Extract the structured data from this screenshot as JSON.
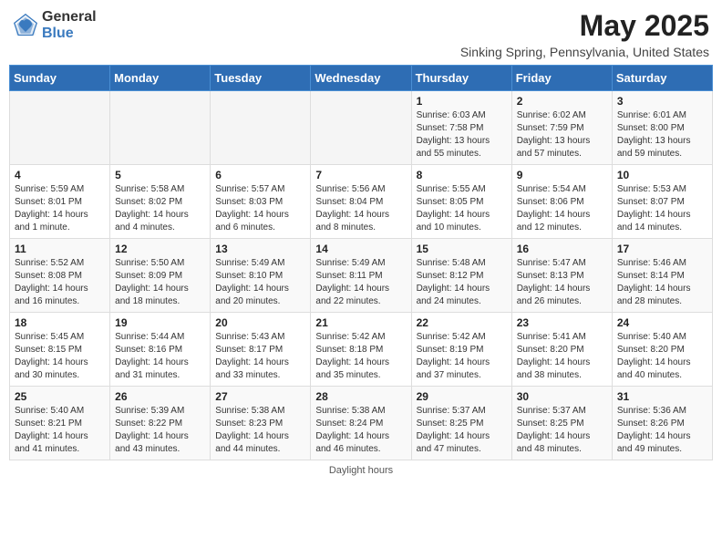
{
  "header": {
    "logo_general": "General",
    "logo_blue": "Blue",
    "month_year": "May 2025",
    "location": "Sinking Spring, Pennsylvania, United States"
  },
  "days_of_week": [
    "Sunday",
    "Monday",
    "Tuesday",
    "Wednesday",
    "Thursday",
    "Friday",
    "Saturday"
  ],
  "footer": {
    "note": "Daylight hours"
  },
  "weeks": [
    [
      {
        "day": "",
        "info": ""
      },
      {
        "day": "",
        "info": ""
      },
      {
        "day": "",
        "info": ""
      },
      {
        "day": "",
        "info": ""
      },
      {
        "day": "1",
        "info": "Sunrise: 6:03 AM\nSunset: 7:58 PM\nDaylight: 13 hours\nand 55 minutes."
      },
      {
        "day": "2",
        "info": "Sunrise: 6:02 AM\nSunset: 7:59 PM\nDaylight: 13 hours\nand 57 minutes."
      },
      {
        "day": "3",
        "info": "Sunrise: 6:01 AM\nSunset: 8:00 PM\nDaylight: 13 hours\nand 59 minutes."
      }
    ],
    [
      {
        "day": "4",
        "info": "Sunrise: 5:59 AM\nSunset: 8:01 PM\nDaylight: 14 hours\nand 1 minute."
      },
      {
        "day": "5",
        "info": "Sunrise: 5:58 AM\nSunset: 8:02 PM\nDaylight: 14 hours\nand 4 minutes."
      },
      {
        "day": "6",
        "info": "Sunrise: 5:57 AM\nSunset: 8:03 PM\nDaylight: 14 hours\nand 6 minutes."
      },
      {
        "day": "7",
        "info": "Sunrise: 5:56 AM\nSunset: 8:04 PM\nDaylight: 14 hours\nand 8 minutes."
      },
      {
        "day": "8",
        "info": "Sunrise: 5:55 AM\nSunset: 8:05 PM\nDaylight: 14 hours\nand 10 minutes."
      },
      {
        "day": "9",
        "info": "Sunrise: 5:54 AM\nSunset: 8:06 PM\nDaylight: 14 hours\nand 12 minutes."
      },
      {
        "day": "10",
        "info": "Sunrise: 5:53 AM\nSunset: 8:07 PM\nDaylight: 14 hours\nand 14 minutes."
      }
    ],
    [
      {
        "day": "11",
        "info": "Sunrise: 5:52 AM\nSunset: 8:08 PM\nDaylight: 14 hours\nand 16 minutes."
      },
      {
        "day": "12",
        "info": "Sunrise: 5:50 AM\nSunset: 8:09 PM\nDaylight: 14 hours\nand 18 minutes."
      },
      {
        "day": "13",
        "info": "Sunrise: 5:49 AM\nSunset: 8:10 PM\nDaylight: 14 hours\nand 20 minutes."
      },
      {
        "day": "14",
        "info": "Sunrise: 5:49 AM\nSunset: 8:11 PM\nDaylight: 14 hours\nand 22 minutes."
      },
      {
        "day": "15",
        "info": "Sunrise: 5:48 AM\nSunset: 8:12 PM\nDaylight: 14 hours\nand 24 minutes."
      },
      {
        "day": "16",
        "info": "Sunrise: 5:47 AM\nSunset: 8:13 PM\nDaylight: 14 hours\nand 26 minutes."
      },
      {
        "day": "17",
        "info": "Sunrise: 5:46 AM\nSunset: 8:14 PM\nDaylight: 14 hours\nand 28 minutes."
      }
    ],
    [
      {
        "day": "18",
        "info": "Sunrise: 5:45 AM\nSunset: 8:15 PM\nDaylight: 14 hours\nand 30 minutes."
      },
      {
        "day": "19",
        "info": "Sunrise: 5:44 AM\nSunset: 8:16 PM\nDaylight: 14 hours\nand 31 minutes."
      },
      {
        "day": "20",
        "info": "Sunrise: 5:43 AM\nSunset: 8:17 PM\nDaylight: 14 hours\nand 33 minutes."
      },
      {
        "day": "21",
        "info": "Sunrise: 5:42 AM\nSunset: 8:18 PM\nDaylight: 14 hours\nand 35 minutes."
      },
      {
        "day": "22",
        "info": "Sunrise: 5:42 AM\nSunset: 8:19 PM\nDaylight: 14 hours\nand 37 minutes."
      },
      {
        "day": "23",
        "info": "Sunrise: 5:41 AM\nSunset: 8:20 PM\nDaylight: 14 hours\nand 38 minutes."
      },
      {
        "day": "24",
        "info": "Sunrise: 5:40 AM\nSunset: 8:20 PM\nDaylight: 14 hours\nand 40 minutes."
      }
    ],
    [
      {
        "day": "25",
        "info": "Sunrise: 5:40 AM\nSunset: 8:21 PM\nDaylight: 14 hours\nand 41 minutes."
      },
      {
        "day": "26",
        "info": "Sunrise: 5:39 AM\nSunset: 8:22 PM\nDaylight: 14 hours\nand 43 minutes."
      },
      {
        "day": "27",
        "info": "Sunrise: 5:38 AM\nSunset: 8:23 PM\nDaylight: 14 hours\nand 44 minutes."
      },
      {
        "day": "28",
        "info": "Sunrise: 5:38 AM\nSunset: 8:24 PM\nDaylight: 14 hours\nand 46 minutes."
      },
      {
        "day": "29",
        "info": "Sunrise: 5:37 AM\nSunset: 8:25 PM\nDaylight: 14 hours\nand 47 minutes."
      },
      {
        "day": "30",
        "info": "Sunrise: 5:37 AM\nSunset: 8:25 PM\nDaylight: 14 hours\nand 48 minutes."
      },
      {
        "day": "31",
        "info": "Sunrise: 5:36 AM\nSunset: 8:26 PM\nDaylight: 14 hours\nand 49 minutes."
      }
    ]
  ]
}
